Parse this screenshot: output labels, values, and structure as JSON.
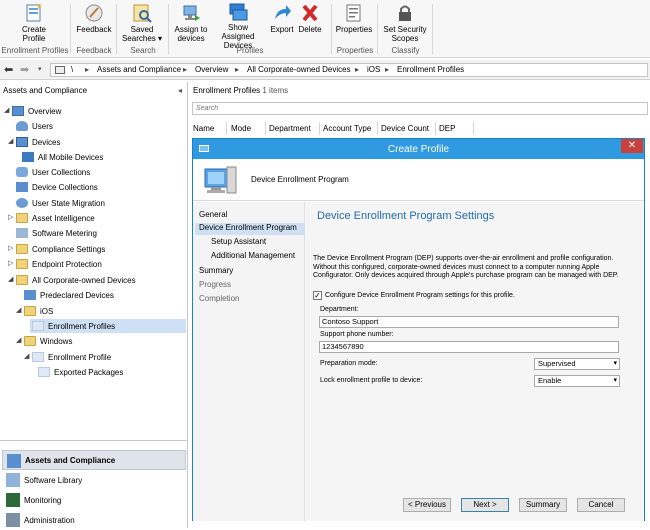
{
  "ribbon": {
    "buttons": [
      {
        "label1": "Create",
        "label2": "Profile",
        "icon": "create-profile-icon"
      },
      {
        "label1": "Feedback",
        "label2": "",
        "icon": "feedback-icon"
      },
      {
        "label1": "Saved",
        "label2": "Searches ▾",
        "icon": "saved-searches-icon"
      },
      {
        "label1": "Assign to",
        "label2": "devices",
        "icon": "assign-icon"
      },
      {
        "label1": "Show Assigned",
        "label2": "Devices",
        "icon": "show-assigned-icon"
      },
      {
        "label1": "Export",
        "label2": "",
        "icon": "export-icon"
      },
      {
        "label1": "Delete",
        "label2": "",
        "icon": "delete-icon"
      },
      {
        "label1": "Properties",
        "label2": "",
        "icon": "properties-icon"
      },
      {
        "label1": "Set Security",
        "label2": "Scopes",
        "icon": "security-scopes-icon"
      }
    ],
    "groups": [
      "Enrollment Profiles",
      "Feedback",
      "Search",
      "Profiles",
      "Properties",
      "Classify"
    ]
  },
  "addressbar": {
    "root": "\\",
    "crumbs": [
      "Assets and Compliance",
      "Overview",
      "All Corporate-owned Devices",
      "iOS",
      "Enrollment Profiles"
    ]
  },
  "leftpane": {
    "title": "Assets and Compliance",
    "tree": [
      {
        "label": "Overview"
      },
      {
        "label": "Users"
      },
      {
        "label": "Devices"
      },
      {
        "label": "All Mobile Devices"
      },
      {
        "label": "User Collections"
      },
      {
        "label": "Device Collections"
      },
      {
        "label": "User State Migration"
      },
      {
        "label": "Asset Intelligence"
      },
      {
        "label": "Software Metering"
      },
      {
        "label": "Compliance Settings"
      },
      {
        "label": "Endpoint Protection"
      },
      {
        "label": "All Corporate-owned Devices"
      },
      {
        "label": "Predeclared Devices"
      },
      {
        "label": "iOS"
      },
      {
        "label": "Enrollment Profiles"
      },
      {
        "label": "Windows"
      },
      {
        "label": "Enrollment Profile"
      },
      {
        "label": "Exported Packages"
      }
    ],
    "workspaces": [
      "Assets and Compliance",
      "Software Library",
      "Monitoring",
      "Administration"
    ]
  },
  "list": {
    "title": "Enrollment Profiles",
    "count": "1 items",
    "search_placeholder": "Search",
    "columns": [
      "Name",
      "Mode",
      "Department",
      "Account Type",
      "Device Count",
      "DEP"
    ]
  },
  "dialog": {
    "title": "Create Profile",
    "header": "Device Enrollment Program",
    "nav": [
      "General",
      "Device Enrollment Program",
      "Setup Assistant",
      "Additional Management",
      "Summary",
      "Progress",
      "Completion"
    ],
    "heading": "Device Enrollment Program Settings",
    "description": "The Device Enrollment Program (DEP) supports over-the-air enrollment and profile configuration. Without this configured, corporate-owned devices must connect to a computer running Apple Configurator. Only devices acquired through Apple's purchase program can be managed with DEP.",
    "checkbox_label": "Configure Device Enrollment Program settings for this profile.",
    "department_label": "Department:",
    "department_value": "Contoso Support",
    "phone_label": "Support phone number:",
    "phone_value": "1234567890",
    "prep_label": "Preparation mode:",
    "prep_value": "Supervised",
    "lock_label": "Lock enrollment profile to device:",
    "lock_value": "Enable",
    "buttons": {
      "previous": "< Previous",
      "next": "Next >",
      "summary": "Summary",
      "cancel": "Cancel"
    }
  },
  "colors": {
    "titlebar": "#2f9ae0",
    "heading": "#1f6ab4",
    "selection": "#cfe0f4",
    "close": "#c9413a"
  }
}
